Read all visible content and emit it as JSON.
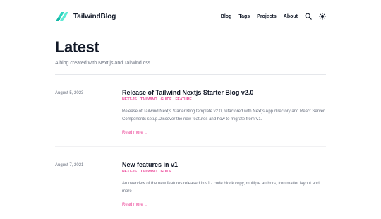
{
  "header": {
    "brand": "TailwindBlog",
    "nav": [
      "Blog",
      "Tags",
      "Projects",
      "About"
    ],
    "icons": [
      "search-icon",
      "sun-icon"
    ]
  },
  "hero": {
    "title": "Latest",
    "subtitle": "A blog created with Next.js and Tailwind.css"
  },
  "posts": [
    {
      "date": "August 5, 2023",
      "title": "Release of Tailwind Nextjs Starter Blog v2.0",
      "tags": [
        "NEXT-JS",
        "TAILWIND",
        "GUIDE",
        "FEATURE"
      ],
      "summary": "Release of Tailwind Nextjs Starter Blog template v2.0, refactored with Nextjs App directory and React Server Components setup.Discover the new features and how to migrate from V1.",
      "read_more": "Read more →"
    },
    {
      "date": "August 7, 2021",
      "title": "New features in v1",
      "tags": [
        "NEXT-JS",
        "TAILWIND",
        "GUIDE"
      ],
      "summary": "An overview of the new features released in v1 - code block copy, multiple authors, frontmatter layout and more",
      "read_more": "Read more →"
    }
  ],
  "colors": {
    "accent": "#ec4899",
    "logo": "#2dd4bf",
    "text": "#111827",
    "muted": "#6b7280"
  }
}
